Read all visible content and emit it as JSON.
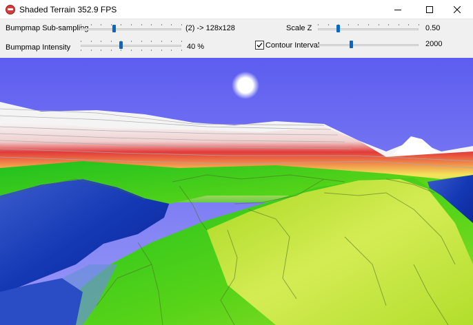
{
  "window": {
    "title": "Shaded Terrain 352.9 FPS",
    "icons": {
      "app": "app-icon",
      "minimize": "minimize-icon",
      "maximize": "maximize-icon",
      "close": "close-icon"
    }
  },
  "controls": {
    "bumpmap_subsampling": {
      "label": "Bumpmap Sub-sampling",
      "value_text": "(2) -> 128x128",
      "position": 0.33
    },
    "bumpmap_intensity": {
      "label": "Bumpmap Intensity",
      "value_text": "40 %",
      "position": 0.4
    },
    "scale_z": {
      "label": "Scale Z",
      "value_text": "0.50",
      "position": 0.2
    },
    "contour_interval": {
      "label": "Contour Interval",
      "checked": true,
      "value_text": "2000",
      "position": 0.33
    }
  },
  "scene": {
    "sky_color": "#6f6ff2",
    "sun_color": "#ffffff",
    "terrain_colors": [
      "#d92a2a",
      "#f0e640",
      "#2fcf2f",
      "#1030b0",
      "#ffffff"
    ]
  }
}
